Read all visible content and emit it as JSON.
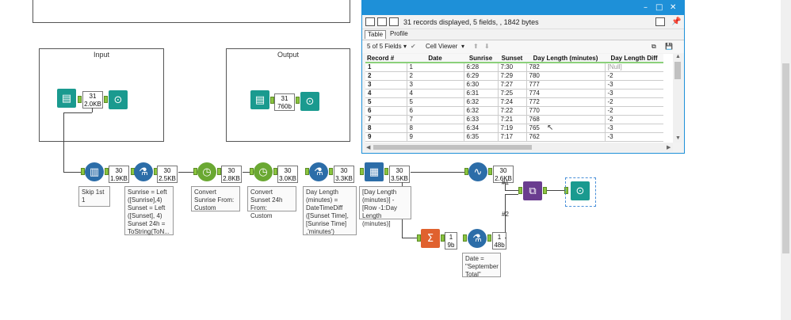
{
  "canvas": {
    "containers": [
      {
        "title": ""
      },
      {
        "title": "Input"
      },
      {
        "title": "Output"
      }
    ],
    "input_stat": {
      "count": "31",
      "size": "2.0KB"
    },
    "output_stat": {
      "count": "31",
      "size": "760b"
    },
    "stats": [
      {
        "count": "30",
        "size": "1.9KB"
      },
      {
        "count": "30",
        "size": "2.5KB"
      },
      {
        "count": "30",
        "size": "2.8KB"
      },
      {
        "count": "30",
        "size": "3.0KB"
      },
      {
        "count": "30",
        "size": "3.3KB"
      },
      {
        "count": "30",
        "size": "3.5KB"
      },
      {
        "count": "30",
        "size": "2.6KB"
      },
      {
        "count": "1",
        "size": "9b"
      },
      {
        "count": "1",
        "size": "48b"
      }
    ],
    "annotations": {
      "skip": "Skip 1st 1",
      "formula1": "Sunrise = Left ([Sunrise],4)\nSunset = Left ([Sunset], 4)\nSunset 24h = ToString(ToN...",
      "convert_sunrise": "Convert Sunrise From:\nCustom",
      "convert_sunset": "Convert Sunset 24h From:\nCustom",
      "daylength": "Day Length (minutes) = DateTimeDiff ([Sunset Time], [Sunrise Time] ,'minutes')",
      "multirow": "[Day Length (minutes)] - [Row -1:Day Length (minutes)]",
      "date_total": "Date = \"September Total\""
    },
    "union_labels": {
      "one": "#1",
      "two": "#2"
    }
  },
  "results": {
    "summary": "31 records displayed, 5 fields, , 1842 bytes",
    "tabs": [
      "Table",
      "Profile"
    ],
    "fields_label": "5 of 5 Fields",
    "cell_viewer_label": "Cell Viewer",
    "columns": [
      "Record #",
      "Date",
      "Sunrise",
      "Sunset",
      "Day Length (minutes)",
      "Day Length Diff"
    ],
    "rows": [
      [
        "1",
        "1",
        "6:28",
        "7:30",
        "782",
        "[Null]"
      ],
      [
        "2",
        "2",
        "6:29",
        "7:29",
        "780",
        "-2"
      ],
      [
        "3",
        "3",
        "6:30",
        "7:27",
        "777",
        "-3"
      ],
      [
        "4",
        "4",
        "6:31",
        "7:25",
        "774",
        "-3"
      ],
      [
        "5",
        "5",
        "6:32",
        "7:24",
        "772",
        "-2"
      ],
      [
        "6",
        "6",
        "6:32",
        "7:22",
        "770",
        "-2"
      ],
      [
        "7",
        "7",
        "6:33",
        "7:21",
        "768",
        "-2"
      ],
      [
        "8",
        "8",
        "6:34",
        "7:19",
        "765",
        "-3"
      ],
      [
        "9",
        "9",
        "6:35",
        "7:17",
        "762",
        "-3"
      ]
    ]
  },
  "colors": {
    "accent": "#1e90d8",
    "input_tool": "#1a9a8f",
    "prep_tool": "#2c6da8",
    "summarize_tool": "#e0612e",
    "union_tool": "#6a3d8f",
    "anchor": "#8bc53f"
  }
}
